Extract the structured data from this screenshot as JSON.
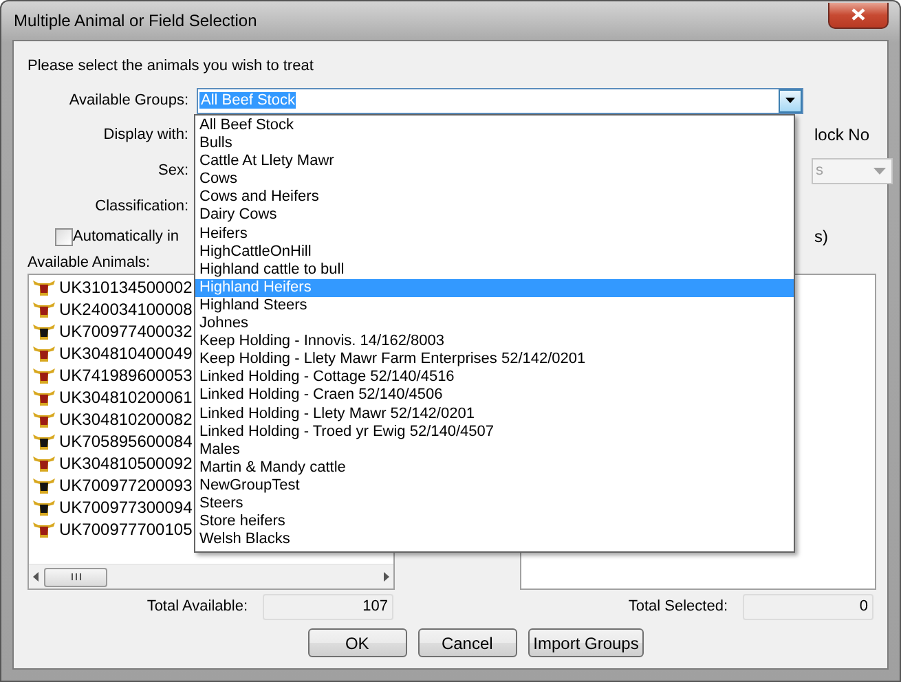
{
  "window": {
    "title": "Multiple Animal or Field Selection"
  },
  "instruction": "Please select the animals you wish to treat",
  "groups_field": {
    "label": "Available Groups:",
    "value": "All Beef Stock",
    "expanded": true
  },
  "form_labels": [
    "Display with:",
    "Sex:",
    "Classification:"
  ],
  "hidden_fragments": {
    "display_option": "lock No",
    "sex_field_text": "s",
    "checkbox_tail": "s)"
  },
  "auto_checkbox": {
    "label": "Automatically in",
    "checked": false
  },
  "available_animals": {
    "label": "Available Animals:",
    "rows": [
      {
        "tag": "UK310134500002",
        "color": "#9c1c14"
      },
      {
        "tag": "UK240034100008",
        "color": "#9c1c14"
      },
      {
        "tag": "UK700977400032",
        "color": "#141414"
      },
      {
        "tag": "UK304810400049",
        "color": "#9c1c14"
      },
      {
        "tag": "UK741989600053",
        "color": "#9c1c14"
      },
      {
        "tag": "UK304810200061",
        "color": "#9c1c14"
      },
      {
        "tag": "UK304810200082",
        "color": "#9c1c14"
      },
      {
        "tag": "UK705895600084",
        "color": "#141414"
      },
      {
        "tag": "UK304810500092",
        "color": "#9c1c14"
      },
      {
        "tag": "UK700977200093",
        "color": "#141414"
      },
      {
        "tag": "UK700977300094",
        "color": "#141414"
      },
      {
        "tag": "UK700977700105",
        "color": "#9c1c14"
      }
    ]
  },
  "totals": {
    "available_label": "Total Available:",
    "available": "107",
    "selected_label": "Total Selected:",
    "selected": "0"
  },
  "buttons": [
    "OK",
    "Cancel",
    "Import Groups"
  ],
  "group_options": [
    {
      "label": "All Beef Stock",
      "selected": false
    },
    {
      "label": "Bulls",
      "selected": false
    },
    {
      "label": "Cattle At Llety Mawr",
      "selected": false
    },
    {
      "label": "Cows",
      "selected": false
    },
    {
      "label": "Cows and Heifers",
      "selected": false
    },
    {
      "label": "Dairy Cows",
      "selected": false
    },
    {
      "label": "Heifers",
      "selected": false
    },
    {
      "label": "HighCattleOnHill",
      "selected": false
    },
    {
      "label": "Highland cattle to bull",
      "selected": false
    },
    {
      "label": "Highland Heifers",
      "selected": true
    },
    {
      "label": "Highland Steers",
      "selected": false
    },
    {
      "label": "Johnes",
      "selected": false
    },
    {
      "label": "Keep Holding - Innovis.  14/162/8003",
      "selected": false
    },
    {
      "label": "Keep Holding - Llety Mawr Farm Enterprises 52/142/0201",
      "selected": false
    },
    {
      "label": "Linked Holding - Cottage 52/140/4516",
      "selected": false
    },
    {
      "label": "Linked Holding - Craen 52/140/4506",
      "selected": false
    },
    {
      "label": "Linked Holding - Llety Mawr 52/142/0201",
      "selected": false
    },
    {
      "label": "Linked Holding - Troed yr Ewig 52/140/4507",
      "selected": false
    },
    {
      "label": "Males",
      "selected": false
    },
    {
      "label": "Martin & Mandy cattle",
      "selected": false
    },
    {
      "label": "NewGroupTest",
      "selected": false
    },
    {
      "label": "Steers",
      "selected": false
    },
    {
      "label": "Store heifers",
      "selected": false
    },
    {
      "label": "Welsh Blacks",
      "selected": false
    }
  ]
}
